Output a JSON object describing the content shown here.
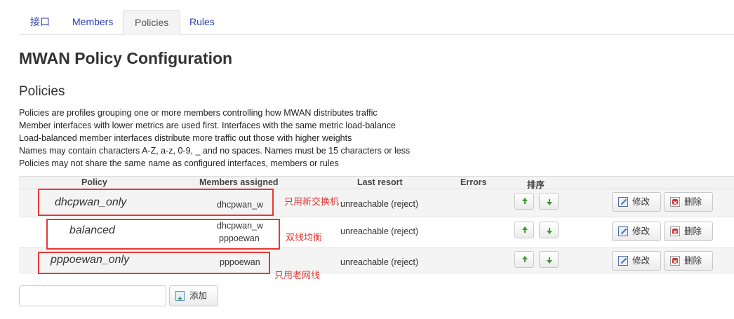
{
  "tabs": [
    {
      "label": "接口",
      "active": false
    },
    {
      "label": "Members",
      "active": false
    },
    {
      "label": "Policies",
      "active": true
    },
    {
      "label": "Rules",
      "active": false
    }
  ],
  "page_title": "MWAN Policy Configuration",
  "section_title": "Policies",
  "description": [
    "Policies are profiles grouping one or more members controlling how MWAN distributes traffic",
    "Member interfaces with lower metrics are used first. Interfaces with the same metric load-balance",
    "Load-balanced member interfaces distribute more traffic out those with higher weights",
    "Names may contain characters A-Z, a-z, 0-9, _ and no spaces. Names must be 15 characters or less",
    "Policies may not share the same name as configured interfaces, members or rules"
  ],
  "table": {
    "headers": {
      "policy": "Policy",
      "members": "Members assigned",
      "last_resort": "Last resort",
      "errors": "Errors",
      "sort": "排序"
    },
    "rows": [
      {
        "name": "dhcpwan_only",
        "members": [
          "dhcpwan_w"
        ],
        "last_resort": "unreachable (reject)",
        "edit": "修改",
        "delete": "删除",
        "annotation": "只用新交换机"
      },
      {
        "name": "balanced",
        "members": [
          "dhcpwan_w",
          "pppoewan"
        ],
        "last_resort": "unreachable (reject)",
        "edit": "修改",
        "delete": "删除",
        "annotation": "双线均衡"
      },
      {
        "name": "pppoewan_only",
        "members": [
          "pppoewan"
        ],
        "last_resort": "unreachable (reject)",
        "edit": "修改",
        "delete": "删除",
        "annotation": "只用老网线"
      }
    ]
  },
  "add_form": {
    "input_value": "",
    "add_label": "添加"
  },
  "icons": {
    "up": "arrow-up-icon",
    "down": "arrow-down-icon",
    "edit": "edit-icon",
    "delete": "delete-icon",
    "add": "add-icon"
  },
  "colors": {
    "link": "#2a3db8",
    "annotation": "#e53935",
    "arrow": "#3c9a2f"
  }
}
